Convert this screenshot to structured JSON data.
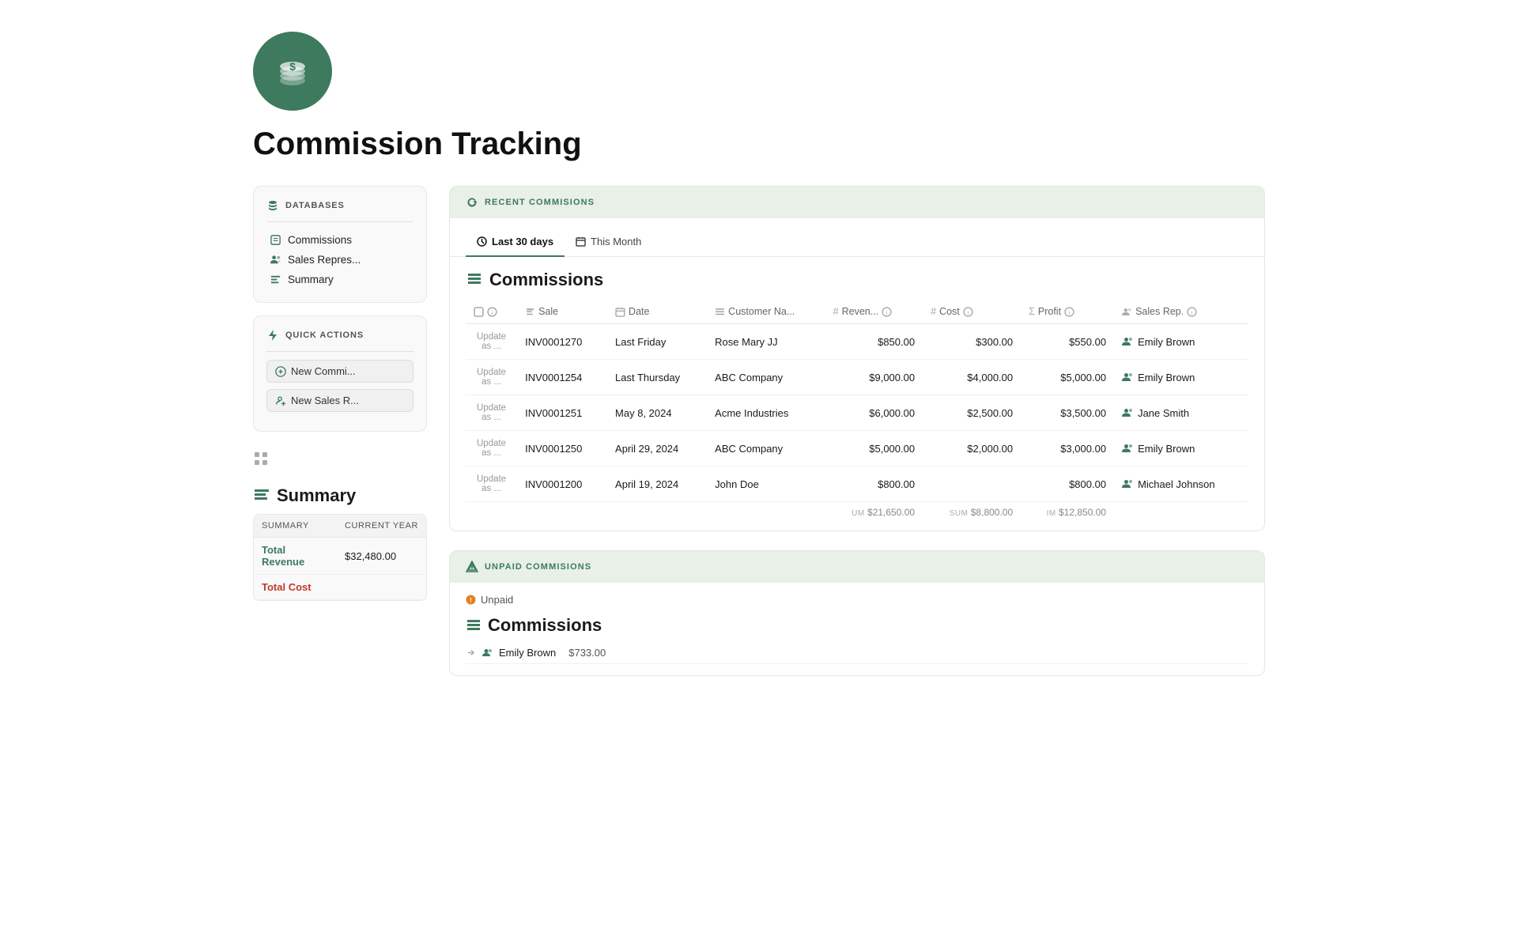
{
  "page": {
    "title": "Commission Tracking"
  },
  "sidebar": {
    "databases_label": "DATABASES",
    "items": [
      {
        "label": "Commissions",
        "icon": "commissions-icon"
      },
      {
        "label": "Sales Repres...",
        "icon": "people-icon"
      },
      {
        "label": "Summary",
        "icon": "summary-icon"
      }
    ],
    "quick_actions_label": "QUICK ACTIONS",
    "actions": [
      {
        "label": "New Commi...",
        "icon": "plus-circle-icon"
      },
      {
        "label": "New Sales R...",
        "icon": "plus-person-icon"
      }
    ]
  },
  "recent_commissions": {
    "section_title": "RECENT COMMISIONS",
    "tabs": [
      {
        "label": "Last 30 days",
        "active": true
      },
      {
        "label": "This Month",
        "active": false
      }
    ],
    "table_title": "Commissions",
    "columns": [
      {
        "label": "",
        "type": "icon"
      },
      {
        "label": "Sale",
        "type": "text"
      },
      {
        "label": "Date",
        "type": "date"
      },
      {
        "label": "Customer Na...",
        "type": "text"
      },
      {
        "label": "Reven...",
        "type": "number"
      },
      {
        "label": "Cost",
        "type": "number"
      },
      {
        "label": "Profit",
        "type": "number"
      },
      {
        "label": "Sales Rep.",
        "type": "people"
      }
    ],
    "rows": [
      {
        "update": "Update as ...",
        "sale": "INV0001270",
        "date": "Last Friday",
        "customer": "Rose Mary JJ",
        "revenue": "$850.00",
        "cost": "$300.00",
        "profit": "$550.00",
        "sales_rep": "Emily Brown"
      },
      {
        "update": "Update as ...",
        "sale": "INV0001254",
        "date": "Last Thursday",
        "customer": "ABC Company",
        "revenue": "$9,000.00",
        "cost": "$4,000.00",
        "profit": "$5,000.00",
        "sales_rep": "Emily Brown"
      },
      {
        "update": "Update as ...",
        "sale": "INV0001251",
        "date": "May 8, 2024",
        "customer": "Acme Industries",
        "revenue": "$6,000.00",
        "cost": "$2,500.00",
        "profit": "$3,500.00",
        "sales_rep": "Jane Smith"
      },
      {
        "update": "Update as ...",
        "sale": "INV0001250",
        "date": "April 29, 2024",
        "customer": "ABC Company",
        "revenue": "$5,000.00",
        "cost": "$2,000.00",
        "profit": "$3,000.00",
        "sales_rep": "Emily Brown"
      },
      {
        "update": "Update as ...",
        "sale": "INV0001200",
        "date": "April 19, 2024",
        "customer": "John Doe",
        "revenue": "$800.00",
        "cost": "",
        "profit": "$800.00",
        "sales_rep": "Michael Johnson"
      }
    ],
    "sums": {
      "revenue_label": "UM",
      "revenue": "$21,650.00",
      "cost_label": "SUM",
      "cost": "$8,800.00",
      "profit_label": "IM",
      "profit": "$12,850.00"
    }
  },
  "summary_widget": {
    "title": "Summary",
    "table": {
      "headers": [
        "Summary",
        "CURRENT YEAR"
      ],
      "rows": [
        {
          "label": "Total Revenue",
          "value": "$32,480.00",
          "label_class": "revenue"
        },
        {
          "label": "Total Cost",
          "value": "",
          "label_class": "cost"
        }
      ]
    }
  },
  "unpaid_commissions": {
    "section_title": "UNPAID COMMISIONS",
    "filter_label": "Unpaid",
    "table_title": "Commissions",
    "sub_rows": [
      {
        "arrow": true,
        "people_icon": true,
        "name": "Emily Brown",
        "amount": "$733.00"
      }
    ]
  }
}
